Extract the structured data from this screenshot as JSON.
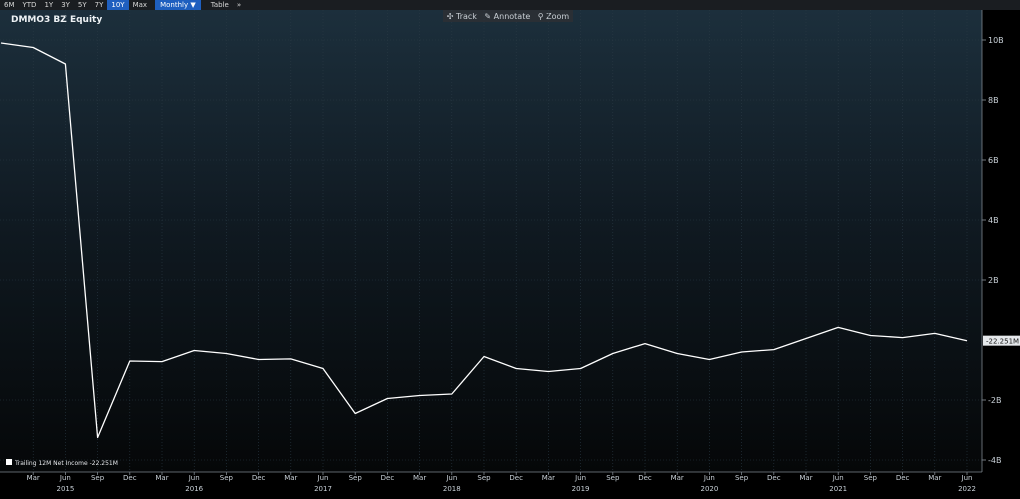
{
  "toolbar": {
    "ranges": [
      "6M",
      "YTD",
      "1Y",
      "3Y",
      "5Y",
      "7Y",
      "10Y",
      "Max"
    ],
    "active_range": "10Y",
    "frequency": "Monthly ▼",
    "table_label": "Table",
    "more_label": "»"
  },
  "tools": {
    "track": "Track",
    "annotate": "Annotate",
    "zoom": "Zoom"
  },
  "security": "DMMO3 BZ Equity",
  "legend_label": "Trailing 12M Net Income -22.251M",
  "last_value_label": "-22.251M",
  "chart_data": {
    "type": "line",
    "title": "DMMO3 BZ Equity",
    "y_unit": "BRL",
    "ylim": [
      -4.4,
      11.0
    ],
    "y_ticks": [
      10,
      8,
      6,
      4,
      2,
      -2,
      -4
    ],
    "y_tick_labels": [
      "10B",
      "8B",
      "6B",
      "4B",
      "2B",
      "-2B",
      "-4B"
    ],
    "x_ticks": [
      "Mar",
      "Jun",
      "Sep",
      "Dec",
      "Mar",
      "Jun",
      "Sep",
      "Dec",
      "Mar",
      "Jun",
      "Sep",
      "Dec",
      "Mar",
      "Jun",
      "Sep",
      "Dec",
      "Mar",
      "Jun",
      "Sep",
      "Dec",
      "Mar",
      "Jun",
      "Sep",
      "Dec",
      "Mar",
      "Jun",
      "Sep",
      "Dec",
      "Mar",
      "Jun"
    ],
    "year_labels": [
      "2015",
      "2016",
      "2017",
      "2018",
      "2019",
      "2020",
      "2021",
      "2022"
    ],
    "series": [
      {
        "name": "Trailing 12M Net Income",
        "x": [
          "2014-12",
          "2015-03",
          "2015-06",
          "2015-09",
          "2015-12",
          "2016-03",
          "2016-06",
          "2016-09",
          "2016-12",
          "2017-03",
          "2017-06",
          "2017-09",
          "2017-12",
          "2018-03",
          "2018-06",
          "2018-09",
          "2018-12",
          "2019-03",
          "2019-06",
          "2019-09",
          "2019-12",
          "2020-03",
          "2020-06",
          "2020-09",
          "2020-12",
          "2021-03",
          "2021-06",
          "2021-09",
          "2021-12",
          "2022-03",
          "2022-06"
        ],
        "values": [
          9.9,
          9.75,
          9.2,
          -3.25,
          -0.7,
          -0.72,
          -0.35,
          -0.45,
          -0.65,
          -0.63,
          -0.95,
          -2.45,
          -1.95,
          -1.85,
          -1.8,
          -0.55,
          -0.95,
          -1.05,
          -0.95,
          -0.45,
          -0.12,
          -0.45,
          -0.65,
          -0.4,
          -0.32,
          0.05,
          0.42,
          0.15,
          0.08,
          0.22,
          -0.022
        ]
      }
    ],
    "line_color": "#ffffff",
    "grid": true,
    "legend_position": "bottom-left"
  }
}
